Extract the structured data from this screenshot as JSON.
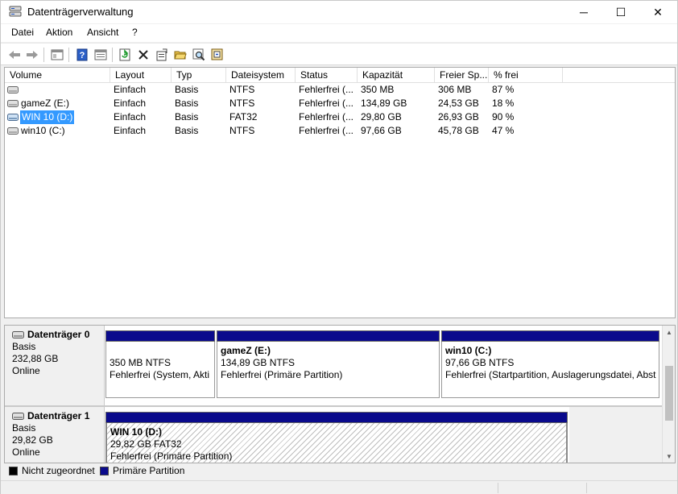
{
  "window": {
    "title": "Datenträgerverwaltung",
    "minimize_glyph": "─",
    "maximize_glyph": "☐",
    "close_glyph": "✕"
  },
  "menu": {
    "items": [
      "Datei",
      "Aktion",
      "Ansicht",
      "?"
    ]
  },
  "toolbar": {
    "buttons": [
      "back-icon",
      "forward-icon",
      "console-tree-icon",
      "help-icon",
      "properties-view-icon",
      "refresh-icon",
      "delete-icon",
      "properties-icon",
      "open-icon",
      "find-icon",
      "settings-icon"
    ]
  },
  "volume_list": {
    "columns": [
      "Volume",
      "Layout",
      "Typ",
      "Dateisystem",
      "Status",
      "Kapazität",
      "Freier Sp...",
      "% frei"
    ],
    "rows": [
      {
        "volume": "",
        "layout": "Einfach",
        "typ": "Basis",
        "fs": "NTFS",
        "status": "Fehlerfrei (...",
        "capacity": "350 MB",
        "free": "306 MB",
        "pct": "87 %"
      },
      {
        "volume": "gameZ (E:)",
        "layout": "Einfach",
        "typ": "Basis",
        "fs": "NTFS",
        "status": "Fehlerfrei (...",
        "capacity": "134,89 GB",
        "free": "24,53 GB",
        "pct": "18 %"
      },
      {
        "volume": "WIN 10 (D:)",
        "layout": "Einfach",
        "typ": "Basis",
        "fs": "FAT32",
        "status": "Fehlerfrei (...",
        "capacity": "29,80 GB",
        "free": "26,93 GB",
        "pct": "90 %"
      },
      {
        "volume": "win10 (C:)",
        "layout": "Einfach",
        "typ": "Basis",
        "fs": "NTFS",
        "status": "Fehlerfrei (...",
        "capacity": "97,66 GB",
        "free": "45,78 GB",
        "pct": "47 %"
      }
    ]
  },
  "disks": [
    {
      "name": "Datenträger 0",
      "type": "Basis",
      "size": "232,88 GB",
      "state": "Online",
      "partitions": [
        {
          "name": "",
          "size_fs": "350 MB NTFS",
          "status": "Fehlerfrei (System, Akti"
        },
        {
          "name": "gameZ  (E:)",
          "size_fs": "134,89 GB NTFS",
          "status": "Fehlerfrei (Primäre Partition)"
        },
        {
          "name": "win10  (C:)",
          "size_fs": "97,66 GB NTFS",
          "status": "Fehlerfrei (Startpartition, Auslagerungsdatei, Abst"
        }
      ]
    },
    {
      "name": "Datenträger 1",
      "type": "Basis",
      "size": "29,82 GB",
      "state": "Online",
      "partitions": [
        {
          "name": "WIN 10  (D:)",
          "size_fs": "29,82 GB FAT32",
          "status": "Fehlerfrei (Primäre Partition)"
        }
      ]
    }
  ],
  "legend": [
    {
      "label": "Nicht zugeordnet",
      "color": "#000000"
    },
    {
      "label": "Primäre Partition",
      "color": "#0a0a8c"
    }
  ],
  "colors": {
    "partition_bar": "#0a0a8c",
    "selection": "#3399ff"
  }
}
